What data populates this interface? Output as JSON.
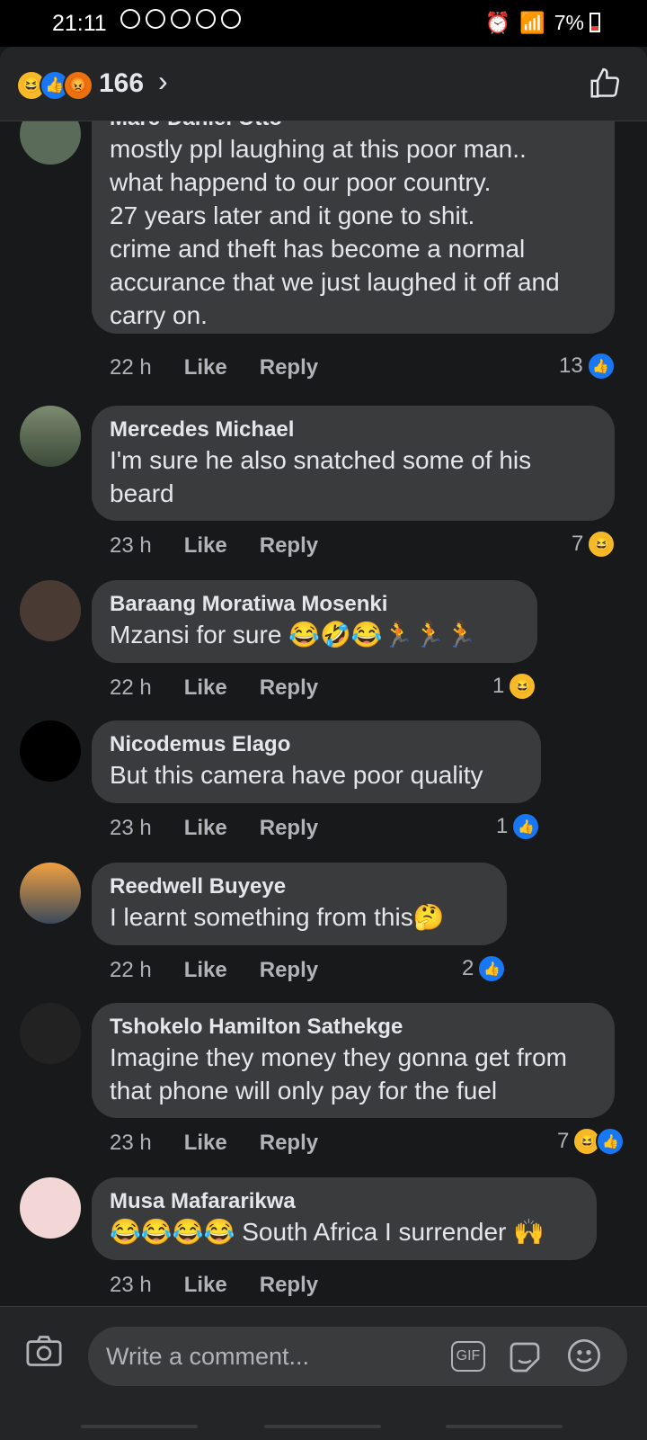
{
  "status_bar": {
    "time": "21:11",
    "battery": "7%"
  },
  "header": {
    "reaction_count": "166"
  },
  "comments": [
    {
      "name": "Marc-Daniel Otto",
      "text": "mostly ppl laughing at this poor man..\nwhat happend to our poor country.\n27 years later and it gone to shit.\ncrime and theft has become a normal\naccurance that we just laughed it off and\ncarry on.",
      "time": "22 h",
      "like_label": "Like",
      "reply_label": "Reply",
      "reaction_count": "13"
    },
    {
      "name": "Mercedes Michael",
      "text": "I'm sure he also snatched some of his\nbeard",
      "time": "23 h",
      "like_label": "Like",
      "reply_label": "Reply",
      "reaction_count": "7"
    },
    {
      "name": "Baraang Moratiwa Mosenki",
      "text": "Mzansi for sure 😂🤣😂🏃🏃🏃",
      "time": "22 h",
      "like_label": "Like",
      "reply_label": "Reply",
      "reaction_count": "1"
    },
    {
      "name": "Nicodemus Elago",
      "text": "But this camera have poor quality",
      "time": "23 h",
      "like_label": "Like",
      "reply_label": "Reply",
      "reaction_count": "1"
    },
    {
      "name": "Reedwell Buyeye",
      "text": "I learnt something from this🤔",
      "time": "22 h",
      "like_label": "Like",
      "reply_label": "Reply",
      "reaction_count": "2"
    },
    {
      "name": "Tshokelo Hamilton Sathekge",
      "text": "Imagine they money they gonna get from\nthat phone will only pay  for the fuel",
      "time": "23 h",
      "like_label": "Like",
      "reply_label": "Reply",
      "reaction_count": "7"
    },
    {
      "name": "Musa Mafararikwa",
      "text": "😂😂😂😂 South Africa I surrender 🙌",
      "time": "23 h",
      "like_label": "Like",
      "reply_label": "Reply",
      "reaction_count": ""
    }
  ],
  "composer": {
    "placeholder": "Write a comment...",
    "gif_label": "GIF"
  },
  "colors": {
    "background": "#18191a",
    "bubble": "#3a3b3c",
    "like_blue": "#1877f2",
    "haha_yellow": "#f7b928"
  }
}
